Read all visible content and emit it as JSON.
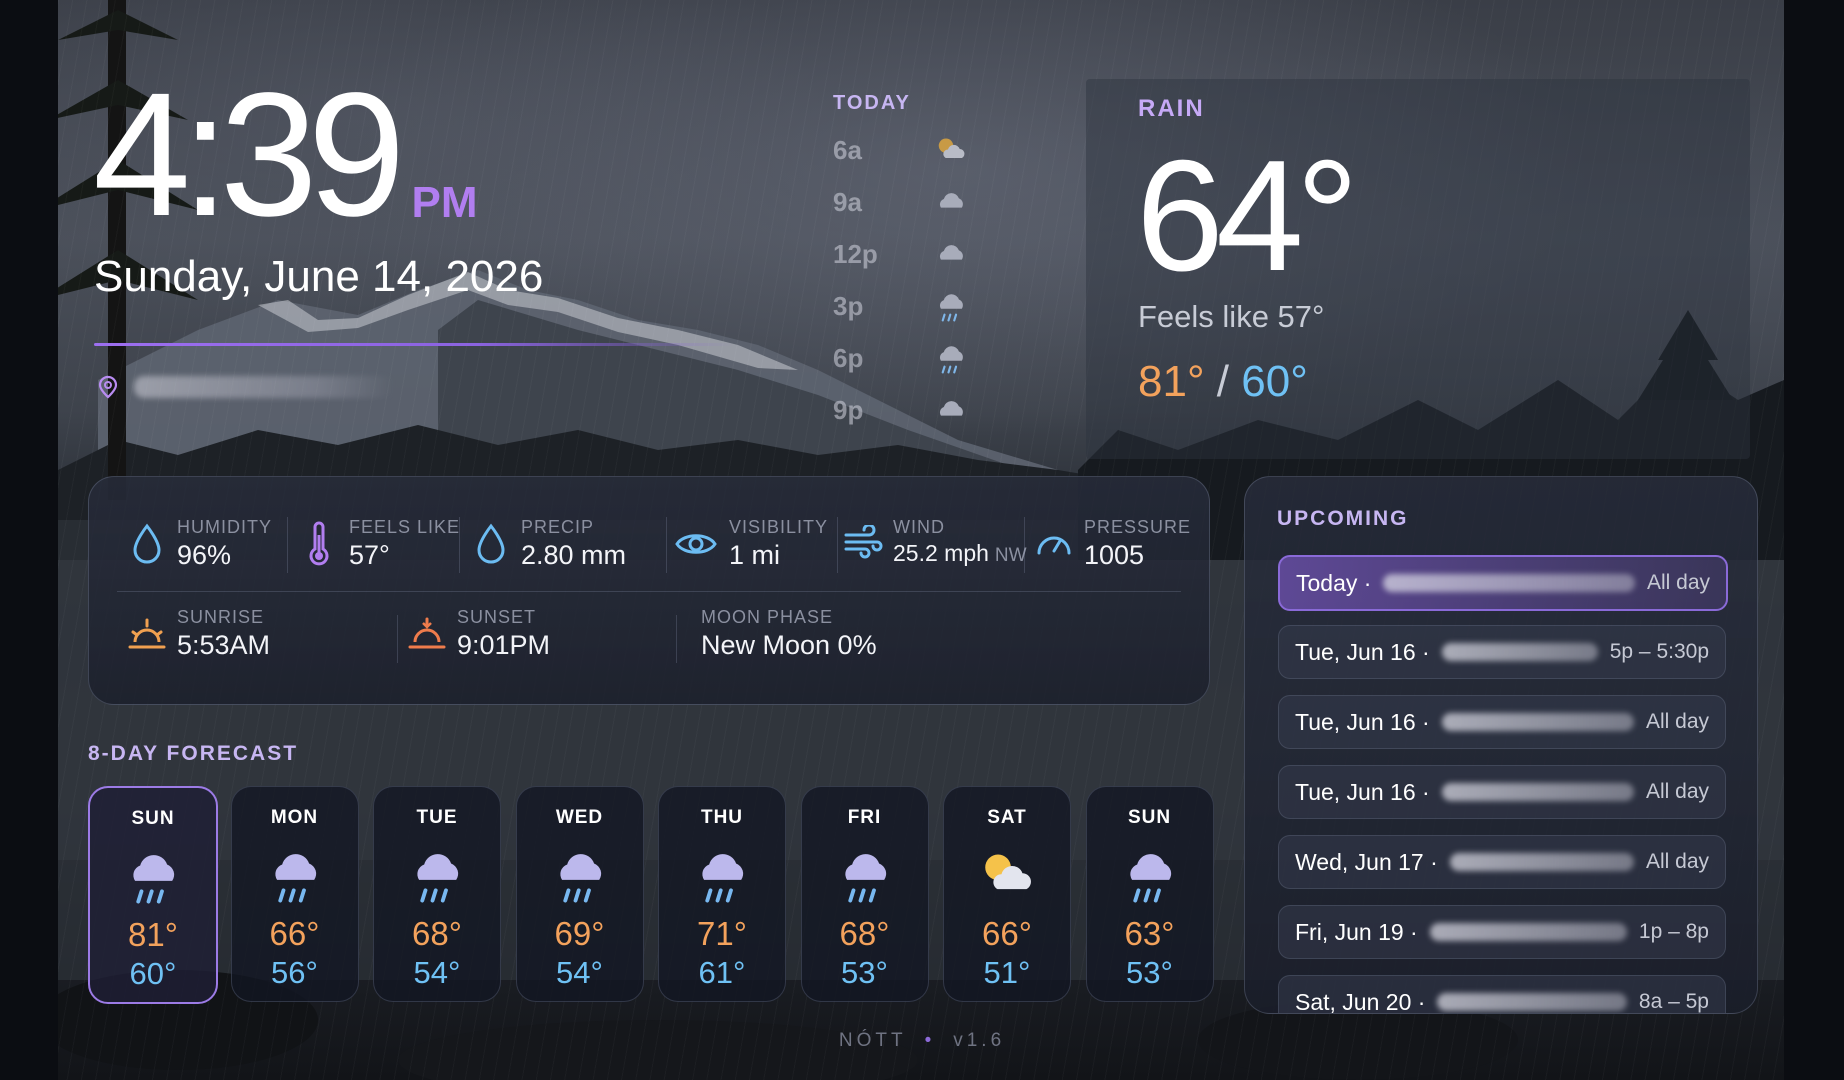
{
  "clock": {
    "time": "4:39",
    "ampm": "PM",
    "date": "Sunday, June 14, 2026"
  },
  "icons": {
    "location": "map-pin-icon"
  },
  "hourly": {
    "title": "TODAY",
    "hours": [
      {
        "label": "6a",
        "icon": "partly-cloudy-icon"
      },
      {
        "label": "9a",
        "icon": "cloud-icon"
      },
      {
        "label": "12p",
        "icon": "cloud-icon"
      },
      {
        "label": "3p",
        "icon": "rain-icon"
      },
      {
        "label": "6p",
        "icon": "rain-icon"
      },
      {
        "label": "9p",
        "icon": "cloud-icon"
      }
    ]
  },
  "current": {
    "condition": "RAIN",
    "temp": "64°",
    "feels_like": "Feels like 57°",
    "high": "81°",
    "separator": "/",
    "low": "60°"
  },
  "details": {
    "humidity": {
      "label": "HUMIDITY",
      "value": "96%"
    },
    "feels_like": {
      "label": "FEELS LIKE",
      "value": "57°"
    },
    "precip": {
      "label": "PRECIP",
      "value": "2.80 mm"
    },
    "visibility": {
      "label": "VISIBILITY",
      "value": "1 mi"
    },
    "wind": {
      "label": "WIND",
      "value": "25.2 mph",
      "direction": "NW"
    },
    "pressure": {
      "label": "PRESSURE",
      "value": "1005"
    },
    "sunrise": {
      "label": "SUNRISE",
      "value": "5:53AM"
    },
    "sunset": {
      "label": "SUNSET",
      "value": "9:01PM"
    },
    "moon": {
      "label": "MOON PHASE",
      "value": "New Moon 0%"
    }
  },
  "forecast": {
    "title": "8-DAY FORECAST",
    "days": [
      {
        "day": "SUN",
        "icon": "rain-icon",
        "high": "81°",
        "low": "60°",
        "active": true
      },
      {
        "day": "MON",
        "icon": "rain-icon",
        "high": "66°",
        "low": "56°"
      },
      {
        "day": "TUE",
        "icon": "rain-icon",
        "high": "68°",
        "low": "54°"
      },
      {
        "day": "WED",
        "icon": "rain-icon",
        "high": "69°",
        "low": "54°"
      },
      {
        "day": "THU",
        "icon": "rain-icon",
        "high": "71°",
        "low": "61°"
      },
      {
        "day": "FRI",
        "icon": "rain-icon",
        "high": "68°",
        "low": "53°"
      },
      {
        "day": "SAT",
        "icon": "partly-cloudy-icon",
        "high": "66°",
        "low": "51°"
      },
      {
        "day": "SUN",
        "icon": "rain-icon",
        "high": "63°",
        "low": "53°"
      }
    ]
  },
  "upcoming": {
    "title": "UPCOMING",
    "events": [
      {
        "date": "Today ·",
        "time": "All day",
        "active": true
      },
      {
        "date": "Tue, Jun 16 ·",
        "time": "5p – 5:30p"
      },
      {
        "date": "Tue, Jun 16 ·",
        "time": "All day"
      },
      {
        "date": "Tue, Jun 16 ·",
        "time": "All day"
      },
      {
        "date": "Wed, Jun 17 ·",
        "time": "All day"
      },
      {
        "date": "Fri, Jun 19 ·",
        "time": "1p – 8p"
      },
      {
        "date": "Sat, Jun 20 ·",
        "time": "8a – 5p"
      }
    ]
  },
  "footer": {
    "app": "NÓTT",
    "dot": "•",
    "version": "v1.6"
  },
  "colors": {
    "accent": "#b17ef0",
    "high": "#f3a25c",
    "low": "#6fc1f4",
    "label": "#c7b6f2"
  }
}
